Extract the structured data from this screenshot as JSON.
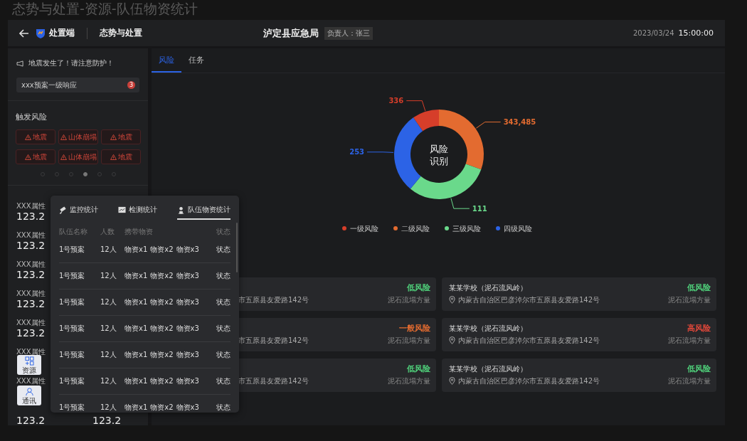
{
  "page_title": "态势与处置-资源-队伍物资统计",
  "header": {
    "app_name": "处置端",
    "module": "态势与处置",
    "agency": "泸定县应急局",
    "owner": "负责人：张三",
    "date": "2023/03/24",
    "time": "15:00:00"
  },
  "alert": {
    "text": "地震发生了！请注意防护！"
  },
  "plan": {
    "label": "xxx预案一级响应",
    "count": "3"
  },
  "triggered_risks": {
    "title": "触发风险",
    "items": [
      "地震",
      "山体崩塌",
      "地震",
      "地震",
      "山体崩塌",
      "地震"
    ],
    "pages": [
      {
        "selected": false
      },
      {
        "selected": false
      },
      {
        "selected": false
      },
      {
        "selected": true
      },
      {
        "selected": false
      },
      {
        "selected": false
      }
    ]
  },
  "stats": [
    {
      "label": "XXX属性",
      "value": "123.2"
    },
    {
      "label": "XXX属性",
      "value": "123.2"
    },
    {
      "label": "XXX属性",
      "value": "123.2"
    },
    {
      "label": "XXX属性",
      "value": "123.2"
    },
    {
      "label": "XXX属性",
      "value": "123.2"
    },
    {
      "label": "XXX属性"
    },
    {
      "label": "XXX属性"
    },
    {
      "value": "123.2",
      "value_2": "123.2"
    }
  ],
  "dock": [
    {
      "kind": "resources",
      "label": "资源"
    },
    {
      "kind": "contacts",
      "label": "通讯"
    }
  ],
  "tabs": [
    {
      "label": "风险",
      "selected": true
    },
    {
      "label": "任务",
      "selected": false
    }
  ],
  "risk_chart": {
    "title_lines": [
      "风险",
      "识别"
    ],
    "segments": [
      {
        "label": "一级风险",
        "value": "336",
        "color": "#d63e2a"
      },
      {
        "label": "二级风险",
        "value": "343,485",
        "color": "#e36b30"
      },
      {
        "label": "三级风险",
        "value": "111",
        "color": "#6ad98b"
      },
      {
        "label": "四级风险",
        "value": "253",
        "color": "#2c63e6"
      }
    ]
  },
  "cards": [
    {
      "address": "市五原县友爱路142号",
      "risk": "低风险",
      "color": "#4fd07a",
      "metric": "泥石流塌方量"
    },
    {
      "name": "某某学校（泥石流风岭）",
      "address": "内蒙古自治区巴彦淖尔市五原县友爱路142号",
      "risk": "低风险",
      "color": "#4fd07a",
      "metric": "泥石流塌方量"
    },
    {
      "address": "市五原县友爱路142号",
      "risk": "一般风险",
      "color": "#e36b30",
      "metric": "泥石流塌方量"
    },
    {
      "name": "某某学校（泥石流风岭）",
      "address": "内蒙古自治区巴彦淖尔市五原县友爱路142号",
      "risk": "高风险",
      "color": "#e0473a",
      "metric": "泥石流塌方量"
    },
    {
      "address": "市五原县友爱路142号",
      "risk": "低风险",
      "color": "#4fd07a",
      "metric": "泥石流塌方量"
    },
    {
      "name": "某某学校（泥石流风岭）",
      "address": "内蒙古自治区巴彦淖尔市五原县友爱路142号",
      "risk": "低风险",
      "color": "#4fd07a",
      "metric": "泥石流塌方量"
    }
  ],
  "popup": {
    "tabs": [
      {
        "kind": "monitor",
        "label": "监控统计",
        "selected": false
      },
      {
        "kind": "detect",
        "label": "检测统计",
        "selected": false
      },
      {
        "kind": "team",
        "label": "队伍物资统计",
        "selected": true
      }
    ],
    "columns": [
      "队伍名称",
      "人数",
      "携带物资",
      "状态"
    ],
    "rows": [
      {
        "name": "1号预案",
        "people": "12人",
        "supplies": [
          "物资x1",
          "物资x2",
          "物资x3"
        ],
        "status": "状态"
      },
      {
        "name": "1号预案",
        "people": "12人",
        "supplies": [
          "物资x1",
          "物资x2",
          "物资x3"
        ],
        "status": "状态"
      },
      {
        "name": "1号预案",
        "people": "12人",
        "supplies": [
          "物资x1",
          "物资x2",
          "物资x3"
        ],
        "status": "状态"
      },
      {
        "name": "1号预案",
        "people": "12人",
        "supplies": [
          "物资x1",
          "物资x2",
          "物资x3"
        ],
        "status": "状态"
      },
      {
        "name": "1号预案",
        "people": "12人",
        "supplies": [
          "物资x1",
          "物资x2",
          "物资x3"
        ],
        "status": "状态"
      },
      {
        "name": "1号预案",
        "people": "12人",
        "supplies": [
          "物资x1",
          "物资x2",
          "物资x3"
        ],
        "status": "状态"
      },
      {
        "name": "1号预案",
        "people": "12人",
        "supplies": [
          "物资x1",
          "物资x2",
          "物资x3"
        ],
        "status": "状态"
      }
    ]
  }
}
